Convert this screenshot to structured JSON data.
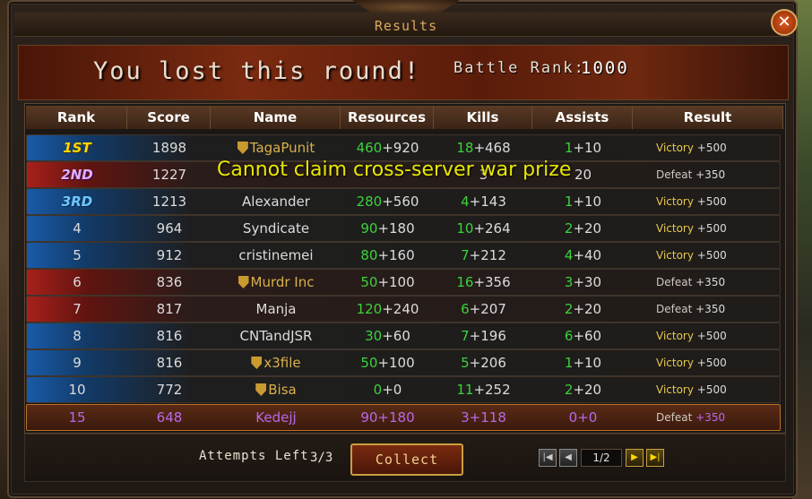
{
  "window": {
    "title": "Results",
    "close_icon": "close-icon"
  },
  "banner": {
    "message": "You lost this round!",
    "battle_rank_label": "Battle Rank:",
    "battle_rank_value": "1000"
  },
  "overlay_message": "Cannot claim cross-server war prize",
  "table": {
    "headers": [
      "Rank",
      "Score",
      "Name",
      "Resources",
      "Kills",
      "Assists",
      "Result"
    ],
    "rows": [
      {
        "rank": "1ST",
        "score": "1898",
        "name": "TagaPunit",
        "guild_icon": true,
        "res_a": "460",
        "res_b": "+920",
        "kills_a": "18",
        "kills_b": "+468",
        "assists_a": "1",
        "assists_b": "+10",
        "result": "Victory",
        "reward": "+500",
        "side": "blue"
      },
      {
        "rank": "2ND",
        "score": "1227",
        "name": "",
        "guild_icon": false,
        "res_a": "",
        "res_b": "",
        "kills_a": "",
        "kills_b": "3",
        "assists_a": "",
        "assists_b": "20",
        "result": "Defeat",
        "reward": "+350",
        "side": "red"
      },
      {
        "rank": "3RD",
        "score": "1213",
        "name": "Alexander",
        "guild_icon": false,
        "res_a": "280",
        "res_b": "+560",
        "kills_a": "4",
        "kills_b": "+143",
        "assists_a": "1",
        "assists_b": "+10",
        "result": "Victory",
        "reward": "+500",
        "side": "blue"
      },
      {
        "rank": "4",
        "score": "964",
        "name": "Syndicate",
        "guild_icon": false,
        "res_a": "90",
        "res_b": "+180",
        "kills_a": "10",
        "kills_b": "+264",
        "assists_a": "2",
        "assists_b": "+20",
        "result": "Victory",
        "reward": "+500",
        "side": "blue"
      },
      {
        "rank": "5",
        "score": "912",
        "name": "cristinemei",
        "guild_icon": false,
        "res_a": "80",
        "res_b": "+160",
        "kills_a": "7",
        "kills_b": "+212",
        "assists_a": "4",
        "assists_b": "+40",
        "result": "Victory",
        "reward": "+500",
        "side": "blue"
      },
      {
        "rank": "6",
        "score": "836",
        "name": "Murdr Inc",
        "guild_icon": true,
        "res_a": "50",
        "res_b": "+100",
        "kills_a": "16",
        "kills_b": "+356",
        "assists_a": "3",
        "assists_b": "+30",
        "result": "Defeat",
        "reward": "+350",
        "side": "red"
      },
      {
        "rank": "7",
        "score": "817",
        "name": "Manja",
        "guild_icon": false,
        "res_a": "120",
        "res_b": "+240",
        "kills_a": "6",
        "kills_b": "+207",
        "assists_a": "2",
        "assists_b": "+20",
        "result": "Defeat",
        "reward": "+350",
        "side": "red"
      },
      {
        "rank": "8",
        "score": "816",
        "name": "CNTandJSR",
        "guild_icon": false,
        "res_a": "30",
        "res_b": "+60",
        "kills_a": "7",
        "kills_b": "+196",
        "assists_a": "6",
        "assists_b": "+60",
        "result": "Victory",
        "reward": "+500",
        "side": "blue"
      },
      {
        "rank": "9",
        "score": "816",
        "name": "x3file",
        "guild_icon": true,
        "res_a": "50",
        "res_b": "+100",
        "kills_a": "5",
        "kills_b": "+206",
        "assists_a": "1",
        "assists_b": "+10",
        "result": "Victory",
        "reward": "+500",
        "side": "blue"
      },
      {
        "rank": "10",
        "score": "772",
        "name": "Bisa",
        "guild_icon": true,
        "res_a": "0",
        "res_b": "+0",
        "kills_a": "11",
        "kills_b": "+252",
        "assists_a": "2",
        "assists_b": "+20",
        "result": "Victory",
        "reward": "+500",
        "side": "blue"
      }
    ],
    "self_row": {
      "rank": "15",
      "score": "648",
      "name": "Kedejj",
      "resources": "90+180",
      "kills": "3+118",
      "assists": "0+0",
      "result": "Defeat",
      "reward": "+350"
    }
  },
  "footer": {
    "attempts_label": "Attempts Left",
    "attempts_value": "3/3",
    "collect_label": "Collect",
    "page_value": "1/2",
    "pager_icons": [
      "first-page-icon",
      "prev-page-icon",
      "next-page-icon",
      "last-page-icon"
    ]
  }
}
